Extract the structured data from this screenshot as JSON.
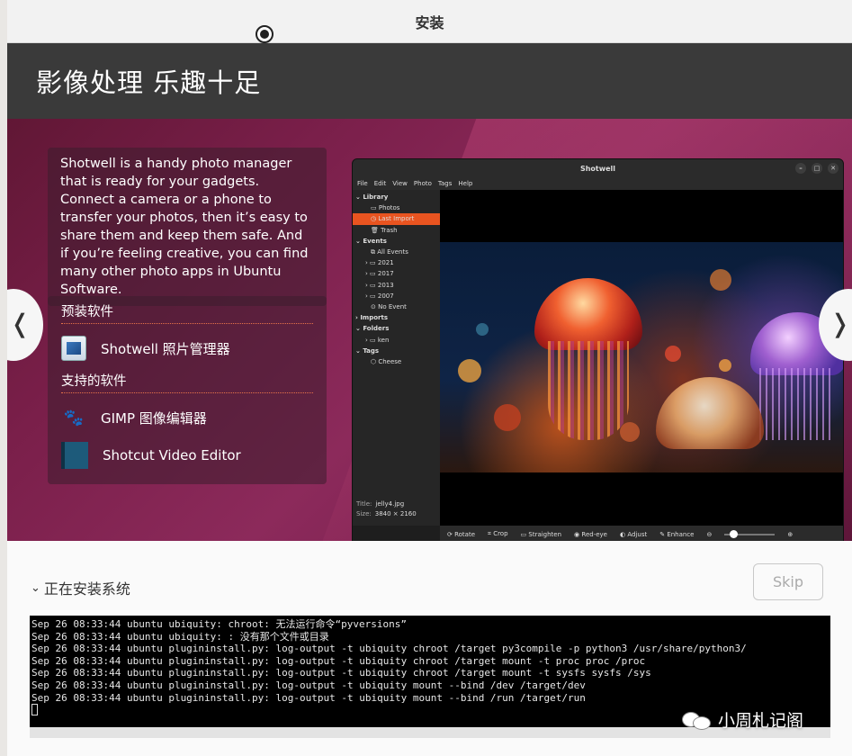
{
  "window": {
    "title": "安装"
  },
  "slide": {
    "title": "影像处理 乐趣十足",
    "description": "Shotwell is a handy photo manager that is ready for your gadgets. Connect a camera or a phone to transfer your photos, then it’s easy to share them and keep them safe. And if you’re feeling creative, you can find many other photo apps in Ubuntu Software.",
    "preinstalled_heading": "预装软件",
    "preinstalled": [
      {
        "label": "Shotwell 照片管理器",
        "icon": "shotwell-icon"
      }
    ],
    "supported_heading": "支持的软件",
    "supported": [
      {
        "label": "GIMP 图像编辑器",
        "icon": "gimp-icon"
      },
      {
        "label": "Shotcut Video Editor",
        "icon": "shotcut-icon"
      }
    ],
    "prev_glyph": "❬",
    "next_glyph": "❭"
  },
  "shotwell": {
    "title": "Shotwell",
    "menu": [
      "File",
      "Edit",
      "View",
      "Photo",
      "Tags",
      "Help"
    ],
    "sidebar": {
      "library": "Library",
      "photos": "Photos",
      "last_import": "Last Import",
      "trash": "Trash",
      "events": "Events",
      "all_events": "All Events",
      "years": [
        "2021",
        "2017",
        "2013",
        "2007"
      ],
      "no_event": "No Event",
      "imports": "Imports",
      "folders": "Folders",
      "folder_ken": "ken",
      "tags": "Tags",
      "tag_cheese": "Cheese"
    },
    "info": {
      "title_label": "Title:",
      "title_value": "jelly4.jpg",
      "size_label": "Size:",
      "size_value": "3840 × 2160"
    },
    "tools": [
      "Rotate",
      "Crop",
      "Straighten",
      "Red-eye",
      "Adjust",
      "Enhance"
    ]
  },
  "progress": {
    "label": "正在安装系统",
    "skip_label": "Skip"
  },
  "log": {
    "lines": [
      "Sep 26 08:33:44 ubuntu ubiquity: chroot: 无法运行命令“pyversions”",
      "Sep 26 08:33:44 ubuntu ubiquity: : 没有那个文件或目录",
      "Sep 26 08:33:44 ubuntu plugininstall.py: log-output -t ubiquity chroot /target py3compile -p python3 /usr/share/python3/",
      "Sep 26 08:33:44 ubuntu plugininstall.py: log-output -t ubiquity chroot /target mount -t proc proc /proc",
      "Sep 26 08:33:44 ubuntu plugininstall.py: log-output -t ubiquity chroot /target mount -t sysfs sysfs /sys",
      "Sep 26 08:33:44 ubuntu plugininstall.py: log-output -t ubiquity mount --bind /dev /target/dev",
      "Sep 26 08:33:44 ubuntu plugininstall.py: log-output -t ubiquity mount --bind /run /target/run"
    ]
  },
  "watermark": {
    "text": "小周札记阁"
  }
}
